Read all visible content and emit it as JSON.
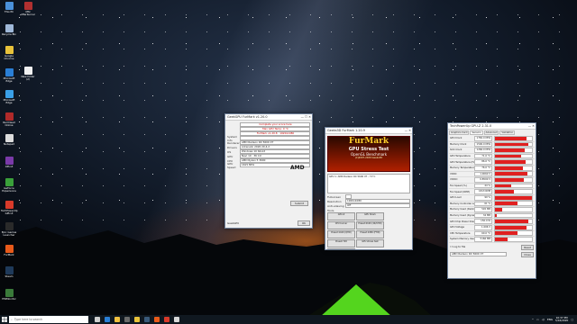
{
  "desktop": {
    "icons": [
      {
        "label": "This PC",
        "color": "#4a90d9"
      },
      {
        "label": "Recycle Bin",
        "color": "#9fb8d8"
      },
      {
        "label": "Google Chrome",
        "color": "#e8c23a"
      },
      {
        "label": "Microsoft Edge",
        "color": "#2a7fd6"
      },
      {
        "label": "Microsoft Edge",
        "color": "#3aa0e8"
      },
      {
        "label": "Red Dead Online",
        "color": "#b02a2a"
      },
      {
        "label": "Notepad",
        "color": "#dcdcdc"
      },
      {
        "label": "CPU-Z",
        "color": "#7a3aa8"
      },
      {
        "label": "GeForce Experience",
        "color": "#3aa03a"
      },
      {
        "label": "TechPowerUp GPU-Z",
        "color": "#d83a2a"
      },
      {
        "label": "Epic Games Launcher",
        "color": "#2a2a2a"
      },
      {
        "label": "FurMark",
        "color": "#e85a1a"
      },
      {
        "label": "Steam",
        "color": "#1f3a5a"
      },
      {
        "label": "HWMonitor",
        "color": "#3a7a3a"
      }
    ],
    "second_column_icons": [
      {
        "label": "MSI Afterburner",
        "color": "#b03030"
      },
      {
        "label": "New folder (2)",
        "color": "#f0f0f0"
      }
    ]
  },
  "cinebench_window": {
    "title": "GeekGPU FurMark v1.20.0",
    "rows": [
      {
        "label": "",
        "value": "Complete your score here"
      },
      {
        "label": "",
        "value": "Max GPU Temp: 0 °C"
      },
      {
        "label": "",
        "value": "FurMark v1.20.8 · 1920x1080"
      },
      {
        "label": "System Info",
        "value": ""
      },
      {
        "label": "Renderer",
        "value": "AMD Radeon RX 5600 XT"
      },
      {
        "label": "Drivers",
        "value": "Adrenalin 2020 20.4.2"
      },
      {
        "label": "OS",
        "value": "Windows 10 64-bit"
      },
      {
        "label": "GPU",
        "value": "Navi 10 · 36 CU"
      },
      {
        "label": "CPU",
        "value": "AMD Ryzen 5 3600"
      },
      {
        "label": "GPU Speed",
        "value": "1615 MHz"
      }
    ],
    "logo_text": "AMD",
    "submit_label": "Submit",
    "footer_left": "GeekGPU",
    "footer_btn": "OK"
  },
  "furmark_window": {
    "title": "Geeks3D FurMark 1.20.9",
    "banner_title": "FurMark",
    "banner_sub1": "GPU Stress Test",
    "banner_sub2": "OpenGL Benchmark",
    "banner_sub3": "(C)2007-2020 Geeks3D",
    "gpu_info": "GPU 1: AMD Radeon RX 5600 XT - 71°C",
    "fullscreen_label": "Fullscreen",
    "resolution_label": "Resolution",
    "resolution_value": "1920x1080",
    "aa_label": "Anti-aliasing",
    "aa_value": "Off",
    "tools_label": "Tools",
    "buttons": [
      "GPU-Z",
      "GPU Shark",
      "CPU burner",
      "Preset:2160 (4K/UHD)",
      "Preset:1440 (QHD)",
      "Preset:1080 (FHD)",
      "Preset:720",
      "GPU stress test",
      "Custom preset"
    ],
    "bottom_links": [
      "Link of the day",
      "Donate",
      "Compare your score",
      "Online scores"
    ],
    "bottom_buttons": [
      "Settings",
      "Log file",
      "About...",
      "Quit"
    ]
  },
  "gpuz_window": {
    "title": "TechPowerUp GPU-Z 2.31.0",
    "tabs": [
      "Graphics Card",
      "Sensors",
      "Advanced",
      "Validation"
    ],
    "sensors": [
      {
        "name": "GPU Clock",
        "value": "1782.0 MHz",
        "fill": 0.85
      },
      {
        "name": "Memory Clock",
        "value": "1500.0 MHz",
        "fill": 0.9
      },
      {
        "name": "SOC Clock",
        "value": "1266.0 MHz",
        "fill": 0.8
      },
      {
        "name": "GPU Temperature",
        "value": "71.0 °C",
        "fill": 0.7
      },
      {
        "name": "GPU Temperature (Hot Spot)",
        "value": "86.0 °C",
        "fill": 0.82
      },
      {
        "name": "Memory Temperature",
        "value": "76.0 °C",
        "fill": 0.75
      },
      {
        "name": "VDDC",
        "value": "1.0060 V",
        "fill": 0.88
      },
      {
        "name": "VDDCI",
        "value": "0.8500 V",
        "fill": 0.78
      },
      {
        "name": "Fan Speed (%)",
        "value": "44 %",
        "fill": 0.44
      },
      {
        "name": "Fan Speed (RPM)",
        "value": "1813 RPM",
        "fill": 0.5
      },
      {
        "name": "GPU Load",
        "value": "99 %",
        "fill": 0.99
      },
      {
        "name": "Memory Controller Load",
        "value": "61 %",
        "fill": 0.61
      },
      {
        "name": "Memory Used (Dedicated)",
        "value": "545 MB",
        "fill": 0.2
      },
      {
        "name": "Memory Used (Dynamic)",
        "value": "34 MB",
        "fill": 0.05
      },
      {
        "name": "GPU Chip Power Draw",
        "value": "150.0 W",
        "fill": 0.9
      },
      {
        "name": "GPU Voltage",
        "value": "1.006 V",
        "fill": 0.86
      },
      {
        "name": "CPU Temperature",
        "value": "60.0 °C",
        "fill": 0.6
      },
      {
        "name": "System Memory Used",
        "value": "5166 MB",
        "fill": 0.35
      }
    ],
    "log_label": "Log to file",
    "reset_label": "Reset",
    "card_name": "AMD Radeon RX 5600 XT",
    "close_label": "Close"
  },
  "taskbar": {
    "search_placeholder": "Type here to search",
    "time": "10:37 PM",
    "date": "5/16/2020",
    "lang": "ENG",
    "icons": [
      {
        "name": "task-view",
        "color": "#cfcfcf"
      },
      {
        "name": "edge",
        "color": "#2a7fd6"
      },
      {
        "name": "file-explorer",
        "color": "#f0c040"
      },
      {
        "name": "store",
        "color": "#6a6a6a"
      },
      {
        "name": "chrome",
        "color": "#e8c23a"
      },
      {
        "name": "steam",
        "color": "#3a5a7a"
      },
      {
        "name": "furmark",
        "color": "#e85a1a"
      },
      {
        "name": "gpuz",
        "color": "#d83a2a"
      },
      {
        "name": "geekgpu",
        "color": "#d8d8d8"
      }
    ]
  }
}
